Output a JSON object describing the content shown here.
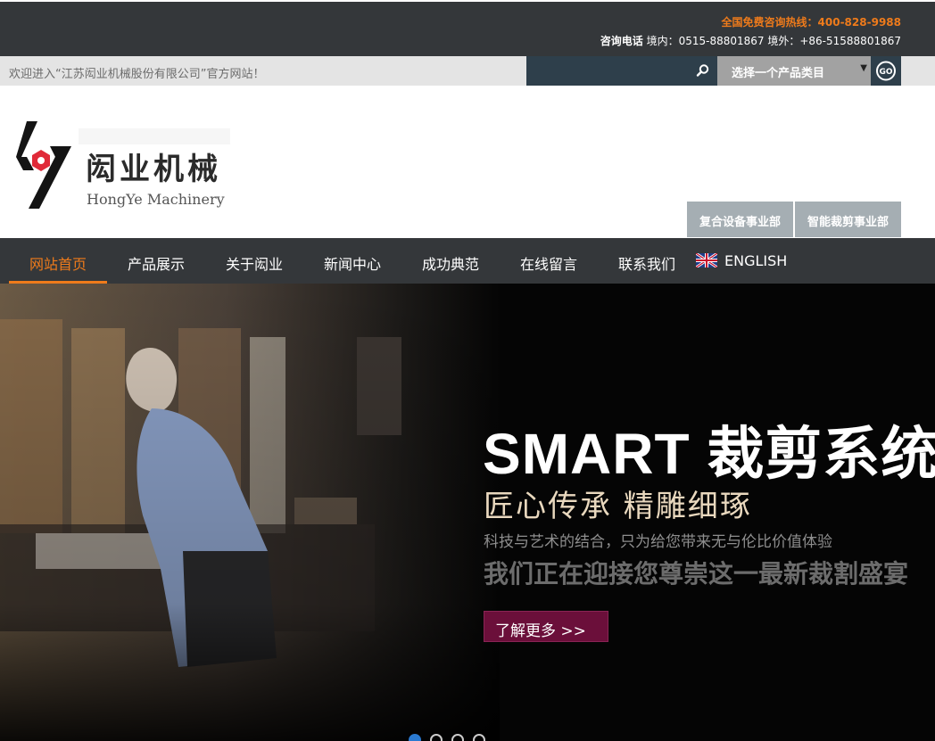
{
  "topbar": {
    "hotline": "全国免费咨询热线：400-828-9988",
    "phone_label": "咨询电话",
    "phone_text": "境内：0515-88801867 境外：+86-51588801867"
  },
  "welcomebar": {
    "welcome_text": "欢迎进入“江苏闳业机械股份有限公司”官方网站！",
    "search_placeholder": "",
    "category_select": "选择一个产品类目"
  },
  "logo": {
    "name_cn": "闳业机械",
    "name_en": "HongYe Machinery"
  },
  "divisions": [
    "复合设备事业部",
    "智能裁剪事业部"
  ],
  "nav": {
    "items": [
      "网站首页",
      "产品展示",
      "关于闳业",
      "新闻中心",
      "成功典范",
      "在线留言",
      "联系我们",
      "ENGLISH"
    ],
    "active": "网站首页"
  },
  "banner": {
    "headline": "SMART 裁剪系统",
    "subheadline": "匠心传承  精雕细琢",
    "tagline": "科技与艺术的结合，只为给您带来无与伦比价值体验",
    "slogan": "我们正在迎接您尊崇这一最新裁割盛宴",
    "more_button": "了解更多 >>",
    "slides_count": 4,
    "active_slide": 1
  },
  "colors": {
    "accent": "#ef7b1b",
    "dark_bar": "#34373a",
    "button": "#6b0f3a"
  }
}
